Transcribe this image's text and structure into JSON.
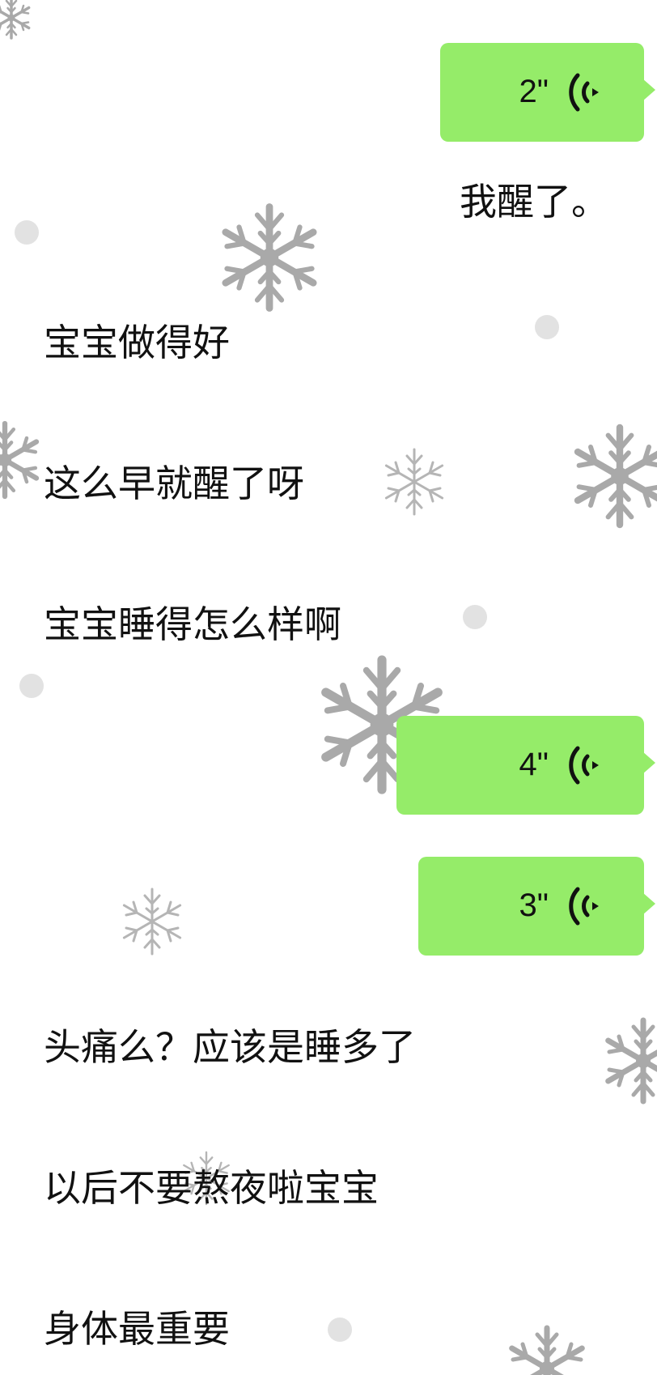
{
  "messages": [
    {
      "side": "right",
      "type": "voice",
      "duration": "2\""
    },
    {
      "side": "right",
      "type": "text",
      "text": "我醒了。"
    },
    {
      "side": "left",
      "type": "text",
      "text": "宝宝做得好"
    },
    {
      "side": "left",
      "type": "text",
      "text": "这么早就醒了呀"
    },
    {
      "side": "left",
      "type": "text",
      "text": "宝宝睡得怎么样啊"
    },
    {
      "side": "right",
      "type": "voice",
      "duration": "4\""
    },
    {
      "side": "right",
      "type": "voice",
      "duration": "3\""
    },
    {
      "side": "left",
      "type": "text",
      "text": "头痛么？应该是睡多了"
    },
    {
      "side": "left",
      "type": "text",
      "text": "以后不要熬夜啦宝宝"
    },
    {
      "side": "left",
      "type": "text",
      "text": "身体最重要"
    }
  ],
  "colors": {
    "voice_bubble": "#95ec69",
    "text": "#111111",
    "background": "#ffffff",
    "snowflake": "#a9a9a9",
    "snow_dot": "#e2e2e2"
  },
  "icons": {
    "voice_wave": "voice-wave-icon",
    "snowflake": "snowflake-icon"
  }
}
